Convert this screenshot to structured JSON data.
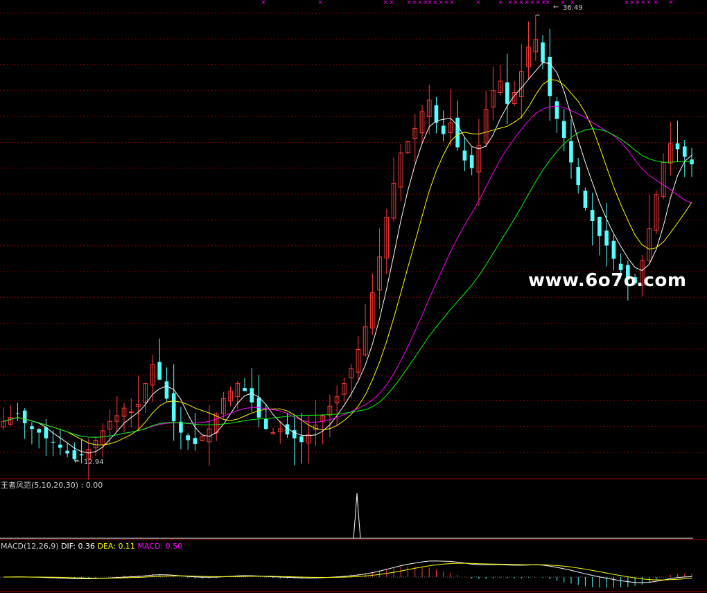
{
  "watermark": "www.6o7o.com",
  "price_panel": {
    "high_label": "36.49",
    "low_label": "12.94",
    "colors": {
      "up": "#ff3b3b",
      "down": "#54ffff",
      "ma5": "#ffffff",
      "ma10": "#ffff00",
      "ma20": "#ff00ff",
      "ma30": "#00ff00",
      "grid": "#8b0000",
      "signal": "#ff00ff"
    }
  },
  "indicator_panel": {
    "name": "王者风范",
    "params": "(5,10,20,30)",
    "sep": ":",
    "value": "0.00"
  },
  "macd_panel": {
    "name": "MACD",
    "params": "(12,26,9)",
    "dif_label": "DIF:",
    "dif_value": "0.36",
    "dea_label": "DEA:",
    "dea_value": "0.11",
    "macd_label": "MACD:",
    "macd_value": "0.50"
  },
  "chart_data": {
    "type": "candlestick",
    "series": [
      {
        "name": "MA(5)"
      },
      {
        "name": "MA(10)"
      },
      {
        "name": "MA(20)"
      },
      {
        "name": "MA(30)"
      }
    ],
    "annotations": [
      "36.49",
      "12.94"
    ],
    "closes": [
      15.0,
      15.2,
      15.4,
      14.9,
      14.6,
      14.4,
      14.1,
      13.9,
      13.6,
      13.3,
      13.0,
      13.2,
      13.5,
      14.0,
      14.5,
      15.0,
      15.3,
      15.7,
      15.5,
      15.9,
      17.0,
      18.0,
      17.2,
      16.2,
      15.0,
      14.4,
      14.0,
      13.8,
      14.2,
      14.6,
      15.4,
      16.2,
      16.6,
      17.0,
      16.6,
      16.0,
      15.2,
      14.6,
      14.4,
      14.6,
      14.3,
      14.1,
      13.9,
      14.3,
      14.8,
      15.3,
      15.8,
      16.3,
      17.0,
      17.8,
      18.8,
      20.0,
      21.8,
      23.7,
      25.8,
      27.6,
      29.2,
      29.8,
      30.5,
      31.4,
      32.0,
      30.8,
      30.2,
      30.8,
      29.5,
      28.8,
      28.4,
      29.6,
      31.5,
      32.5,
      33.0,
      31.8,
      32.4,
      33.5,
      34.8,
      35.2,
      34.0,
      32.2,
      31.0,
      30.0,
      28.7,
      27.5,
      26.3,
      25.6,
      24.8,
      24.3,
      23.6,
      23.0,
      22.5,
      22.3,
      23.5,
      25.2,
      27.0,
      28.7,
      29.7,
      29.4,
      29.0,
      28.6
    ]
  }
}
